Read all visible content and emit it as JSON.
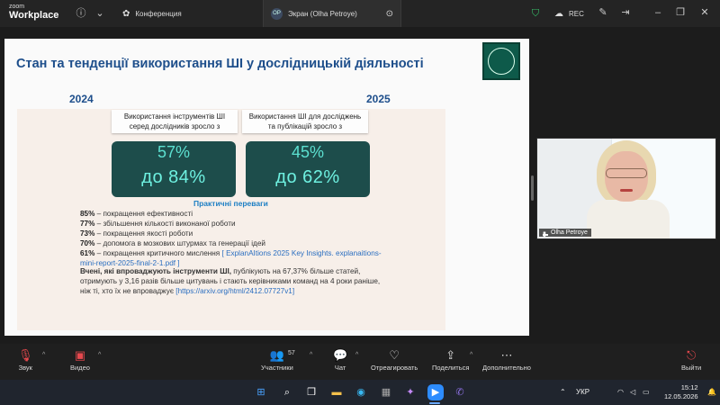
{
  "app": {
    "logo_top": "zoom",
    "logo_bottom": "Workplace"
  },
  "titlebar": {
    "tab_meeting": "Конференция",
    "tab_share_badge": "OP",
    "tab_share": "Экран (Olha Petroye)",
    "rec": "REC"
  },
  "slide": {
    "title": "Стан та тенденції використання ШІ у дослідницькій діяльності",
    "year_left": "2024",
    "year_right": "2025",
    "cards": [
      {
        "label": "Використання інструментів ШІ серед дослідників зросло з",
        "from": "57%",
        "to": "до 84%"
      },
      {
        "label": "Використання ШІ для досліджень та публікацій зросло з",
        "from": "45%",
        "to": "до 62%"
      }
    ],
    "section_title": "Практичні переваги",
    "benefits": [
      {
        "pct": "85%",
        "text": " – покращення ефективності"
      },
      {
        "pct": "77%",
        "text": " – збільшення кількості виконаної роботи"
      },
      {
        "pct": "73%",
        "text": " – покращення якості роботи"
      },
      {
        "pct": "70%",
        "text": " – допомога в мозкових штурмах та генерації ідей"
      },
      {
        "pct": "61%",
        "text": " – покращення критичного мислення ",
        "link": "[ ExplanAItions 2025 Key Insights. explanaitions-mini-report-2025-final-2-1.pdf ]"
      }
    ],
    "para_bold": "Вчені, які впроваджують інструменти ШІ,",
    "para_rest": " публікують на 67,37% більше статей,",
    "para_line2": "отримують у 3,16 разів більше цитувань і стають керівниками команд на 4 роки раніше, ніж ті, хто їх не впроваджує",
    "para_link": "[https://arxiv.org/html/2412.07727v1]"
  },
  "participant": {
    "name": "Olha Petroye"
  },
  "toolbar": {
    "audio": "Звук",
    "video": "Видео",
    "participants": "Участники",
    "participants_count": "57",
    "chat": "Чат",
    "react": "Отреагировать",
    "share": "Поделиться",
    "more": "Дополнительно",
    "leave": "Выйти"
  },
  "taskbar": {
    "lang": "УКР",
    "time": "15:12",
    "date": "12.05.2026"
  }
}
